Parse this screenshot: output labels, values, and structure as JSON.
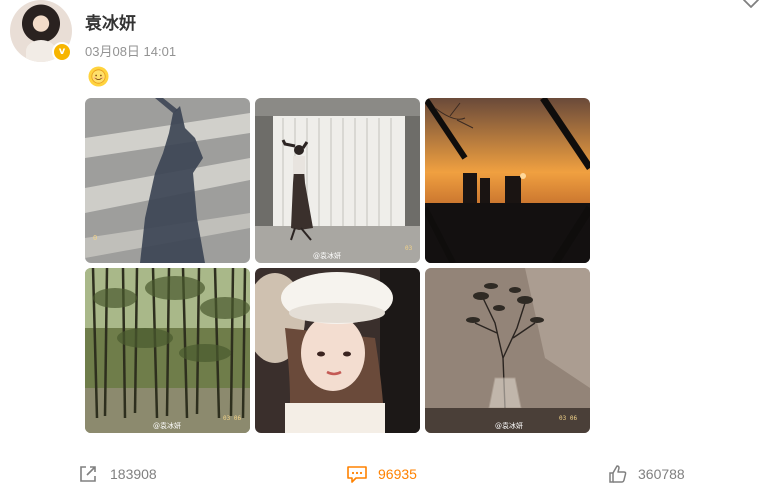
{
  "post": {
    "author": "袁冰妍",
    "timestamp": "03月08日 14:01",
    "verified_badge": "v",
    "content_emoji": "sun-smile-emoji"
  },
  "images": [
    {
      "name": "shadow-on-road",
      "colors": [
        "#a4a4a4",
        "#3f4858"
      ]
    },
    {
      "name": "dancer-silhouette-window",
      "colors": [
        "#d8d6d1",
        "#2b2523"
      ],
      "watermark": "@袁冰妍",
      "stamp": "03"
    },
    {
      "name": "sunset-through-window",
      "colors": [
        "#f0a040",
        "#141414"
      ]
    },
    {
      "name": "bamboo-forest",
      "colors": [
        "#5c6b3e",
        "#2a2a1f"
      ],
      "watermark": "@袁冰妍",
      "stamp": "03 06"
    },
    {
      "name": "portrait-white-beret",
      "colors": [
        "#f2e7df",
        "#3c2e2b"
      ]
    },
    {
      "name": "plant-in-vase",
      "colors": [
        "#7a6a5e",
        "#2b2623"
      ],
      "watermark": "@袁冰妍",
      "stamp": "03 06"
    }
  ],
  "actions": {
    "share": {
      "count": "183908",
      "icon": "share-icon"
    },
    "comment": {
      "count": "96935",
      "icon": "comment-icon",
      "color": "#ff8200"
    },
    "like": {
      "count": "360788",
      "icon": "thumbs-up-icon"
    }
  },
  "menu": {
    "icon": "chevron-down-icon"
  }
}
